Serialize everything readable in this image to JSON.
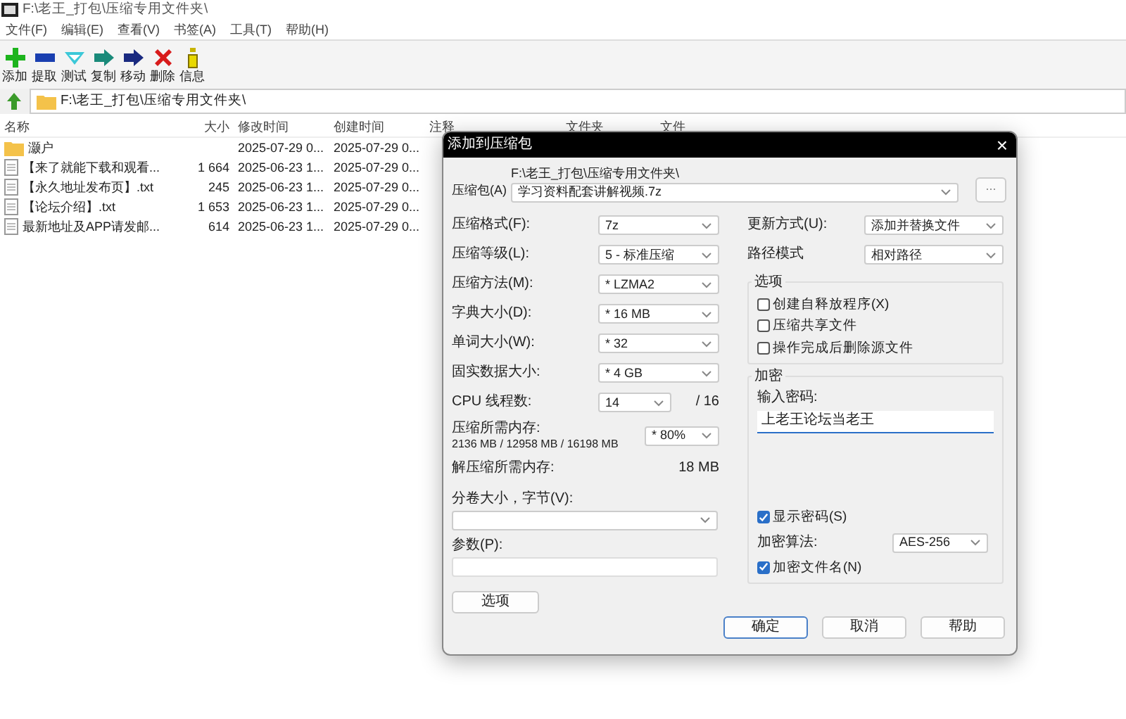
{
  "window": {
    "title": "F:\\老王_打包\\压缩专用文件夹\\"
  },
  "menu": [
    "文件(F)",
    "编辑(E)",
    "查看(V)",
    "书签(A)",
    "工具(T)",
    "帮助(H)"
  ],
  "toolbar": [
    {
      "kind": "add",
      "label": "添加"
    },
    {
      "kind": "extract",
      "label": "提取"
    },
    {
      "kind": "test",
      "label": "测试"
    },
    {
      "kind": "copy",
      "label": "复制"
    },
    {
      "kind": "move",
      "label": "移动"
    },
    {
      "kind": "delete",
      "label": "删除"
    },
    {
      "kind": "info",
      "label": "信息"
    }
  ],
  "address": "F:\\老王_打包\\压缩专用文件夹\\",
  "columns": [
    "名称",
    "大小",
    "修改时间",
    "创建时间",
    "注释",
    "文件夹",
    "文件"
  ],
  "rows": [
    {
      "kind": "folder",
      "name": "灏户",
      "modified": "2025-07-29 0...",
      "created": "2025-07-29 0..."
    },
    {
      "kind": "file",
      "name": "【来了就能下载和观看...",
      "size": "1 664",
      "modified": "2025-06-23 1...",
      "created": "2025-07-29 0..."
    },
    {
      "kind": "file",
      "name": "【永久地址发布页】.txt",
      "size": "245",
      "modified": "2025-06-23 1...",
      "created": "2025-07-29 0..."
    },
    {
      "kind": "file",
      "name": "【论坛介绍】.txt",
      "size": "1 653",
      "modified": "2025-06-23 1...",
      "created": "2025-07-29 0..."
    },
    {
      "kind": "file",
      "name": "最新地址及APP请发邮...",
      "size": "614",
      "modified": "2025-06-23 1...",
      "created": "2025-07-29 0..."
    }
  ],
  "dialog": {
    "title": "添加到压缩包",
    "close": "×",
    "archive": {
      "label": "压缩包(A)",
      "path": "F:\\老王_打包\\压缩专用文件夹\\",
      "value": "学习资料配套讲解视频.7z",
      "browse": "..."
    },
    "left_fields": [
      {
        "label": "压缩格式(F):",
        "value": "7z"
      },
      {
        "label": "压缩等级(L):",
        "value": "5 - 标准压缩"
      },
      {
        "label": "压缩方法(M):",
        "value": "* LZMA2"
      },
      {
        "label": "字典大小(D):",
        "value": "* 16 MB"
      },
      {
        "label": "单词大小(W):",
        "value": "* 32"
      },
      {
        "label": "固实数据大小:",
        "value": "* 4 GB"
      }
    ],
    "cpu": {
      "label": "CPU 线程数:",
      "value": "14",
      "total": "/ 16"
    },
    "memory": {
      "label": "压缩所需内存:",
      "usage": "2136 MB / 12958 MB / 16198 MB",
      "value": "* 80%"
    },
    "decompress": {
      "label": "解压缩所需内存:",
      "value": "18 MB"
    },
    "split": {
      "label": "分卷大小，字节(V):"
    },
    "params": {
      "label": "参数(P):"
    },
    "options_button": "选项",
    "right_fields": [
      {
        "label": "更新方式(U):",
        "value": "添加并替换文件"
      },
      {
        "label": "路径模式",
        "value": "相对路径"
      }
    ],
    "options": {
      "title": "选项",
      "checkboxes": [
        {
          "label": "创建自释放程序(X)",
          "checked": false
        },
        {
          "label": "压缩共享文件",
          "checked": false
        },
        {
          "label": "操作完成后删除源文件",
          "checked": false
        }
      ]
    },
    "encryption": {
      "title": "加密",
      "password_label": "输入密码:",
      "password": "上老王论坛当老王",
      "show_password": {
        "label": "显示密码(S)",
        "checked": true
      },
      "method": {
        "label": "加密算法:",
        "value": "AES-256"
      },
      "encrypt_names": {
        "label": "加密文件名(N)",
        "checked": true
      }
    },
    "buttons": [
      {
        "label": "确定",
        "default": true
      },
      {
        "label": "取消",
        "default": false
      },
      {
        "label": "帮助",
        "default": false
      }
    ]
  }
}
